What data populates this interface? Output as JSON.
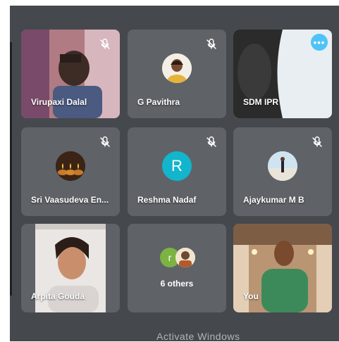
{
  "participants": [
    {
      "name": "Virupaxi Dalal",
      "muted": true
    },
    {
      "name": "G Pavithra",
      "muted": true
    },
    {
      "name": "SDM IPR",
      "muted": false,
      "more_label": "•••"
    },
    {
      "name": "Sri Vaasudeva En...",
      "muted": true
    },
    {
      "name": "Reshma Nadaf",
      "muted": true,
      "initial": "R",
      "avatar_color": "#12b5cb"
    },
    {
      "name": "Ajaykumar M B",
      "muted": true
    },
    {
      "name": "Arpita Gouda",
      "muted": false
    },
    {
      "name": "6 others",
      "avatar_initial": "r"
    },
    {
      "name": "You",
      "muted": false
    }
  ],
  "watermark": "Activate Windows",
  "colors": {
    "stage_bg": "#45494d",
    "tile_bg": "#5f6368",
    "selected_border": "#8ed1f0",
    "more_button": "#4fc3f7"
  }
}
